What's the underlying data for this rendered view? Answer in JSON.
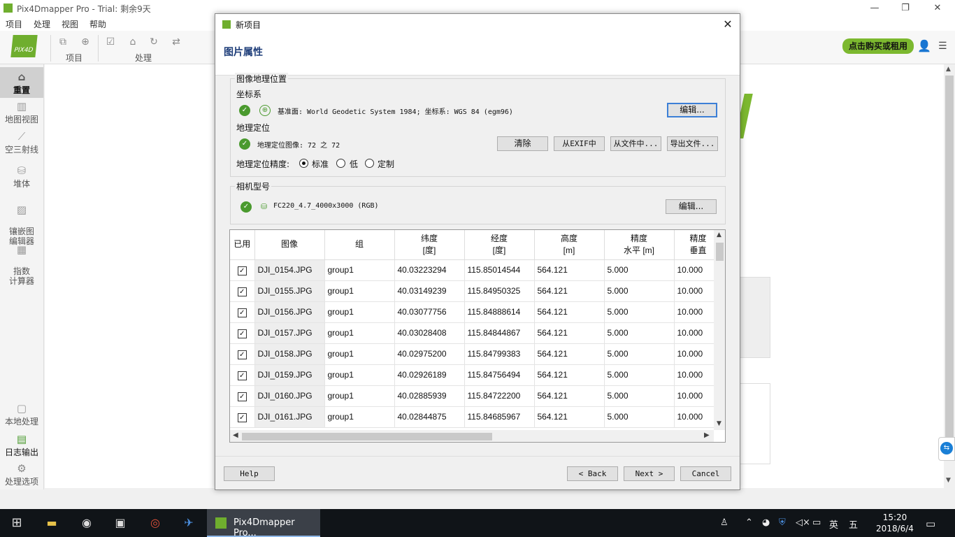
{
  "app": {
    "title": "Pix4Dmapper Pro - Trial: 剩余9天",
    "logo_text": "PIX4D",
    "menu": [
      "项目",
      "处理",
      "视图",
      "帮助"
    ],
    "toolbar_groups": [
      "项目",
      "处理"
    ],
    "buy_button": "点击购买或租用"
  },
  "sidebar": {
    "items": [
      {
        "label": "重置",
        "icon": "home-icon",
        "glyph": "⌂"
      },
      {
        "label": "地图视图",
        "icon": "map-icon",
        "glyph": "▥"
      },
      {
        "label": "空三射线",
        "icon": "rays-icon",
        "glyph": "⟋"
      },
      {
        "label": "堆体",
        "icon": "volume-icon",
        "glyph": "⛁"
      },
      {
        "label": "镶嵌图\n编辑器",
        "icon": "mosaic-editor-icon",
        "glyph": "▨"
      },
      {
        "label": "指数\n计算器",
        "icon": "index-calculator-icon",
        "glyph": "▦"
      },
      {
        "label": "本地处理",
        "icon": "local-processing-icon",
        "glyph": "▢"
      },
      {
        "label": "日志输出",
        "icon": "log-icon",
        "glyph": "▤"
      },
      {
        "label": "处理选项",
        "icon": "gear-icon",
        "glyph": "⚙"
      }
    ]
  },
  "dialog": {
    "title": "新项目",
    "heading": "图片属性",
    "geo_group": {
      "title": "图像地理位置",
      "coord_label": "坐标系",
      "coord_value": "基准面: World Geodetic System 1984; 坐标系: WGS 84 (egm96)",
      "coord_edit": "编辑...",
      "geoloc_label": "地理定位",
      "geoloc_value": "地理定位图像: 72 之 72",
      "clear": "清除",
      "from_exif": "从EXIF中",
      "from_file": "从文件中...",
      "export_file": "导出文件...",
      "accuracy_label": "地理定位精度:",
      "accuracy_options": [
        "标准",
        "低",
        "定制"
      ],
      "accuracy_selected": "标准"
    },
    "camera_group": {
      "title": "相机型号",
      "camera_value": "FC220_4.7_4000x3000 (RGB)",
      "edit": "编辑..."
    },
    "table": {
      "headers": [
        "已用",
        "图像",
        "组",
        "纬度\n[度]",
        "经度\n[度]",
        "高度\n[m]",
        "精度\n水平 [m]",
        "精度\n垂直"
      ],
      "rows": [
        {
          "used": true,
          "image": "DJI_0154.JPG",
          "group": "group1",
          "lat": "40.03223294",
          "lon": "115.85014544",
          "alt": "564.121",
          "h_acc": "5.000",
          "v_acc": "10.000"
        },
        {
          "used": true,
          "image": "DJI_0155.JPG",
          "group": "group1",
          "lat": "40.03149239",
          "lon": "115.84950325",
          "alt": "564.121",
          "h_acc": "5.000",
          "v_acc": "10.000"
        },
        {
          "used": true,
          "image": "DJI_0156.JPG",
          "group": "group1",
          "lat": "40.03077756",
          "lon": "115.84888614",
          "alt": "564.121",
          "h_acc": "5.000",
          "v_acc": "10.000"
        },
        {
          "used": true,
          "image": "DJI_0157.JPG",
          "group": "group1",
          "lat": "40.03028408",
          "lon": "115.84844867",
          "alt": "564.121",
          "h_acc": "5.000",
          "v_acc": "10.000"
        },
        {
          "used": true,
          "image": "DJI_0158.JPG",
          "group": "group1",
          "lat": "40.02975200",
          "lon": "115.84799383",
          "alt": "564.121",
          "h_acc": "5.000",
          "v_acc": "10.000"
        },
        {
          "used": true,
          "image": "DJI_0159.JPG",
          "group": "group1",
          "lat": "40.02926189",
          "lon": "115.84756494",
          "alt": "564.121",
          "h_acc": "5.000",
          "v_acc": "10.000"
        },
        {
          "used": true,
          "image": "DJI_0160.JPG",
          "group": "group1",
          "lat": "40.02885939",
          "lon": "115.84722200",
          "alt": "564.121",
          "h_acc": "5.000",
          "v_acc": "10.000"
        },
        {
          "used": true,
          "image": "DJI_0161.JPG",
          "group": "group1",
          "lat": "40.02844875",
          "lon": "115.84685967",
          "alt": "564.121",
          "h_acc": "5.000",
          "v_acc": "10.000"
        }
      ]
    },
    "buttons": {
      "help": "Help",
      "back": "< Back",
      "next": "Next >",
      "cancel": "Cancel"
    }
  },
  "taskbar": {
    "active_app": "Pix4Dmapper Pro...",
    "ime_lang": "英",
    "ime_mode": "五",
    "time": "15:20",
    "date": "2018/6/4"
  },
  "colors": {
    "brand_green": "#6fae2e",
    "heading_blue": "#1f3e7a",
    "focus_blue": "#3c7fd6"
  }
}
